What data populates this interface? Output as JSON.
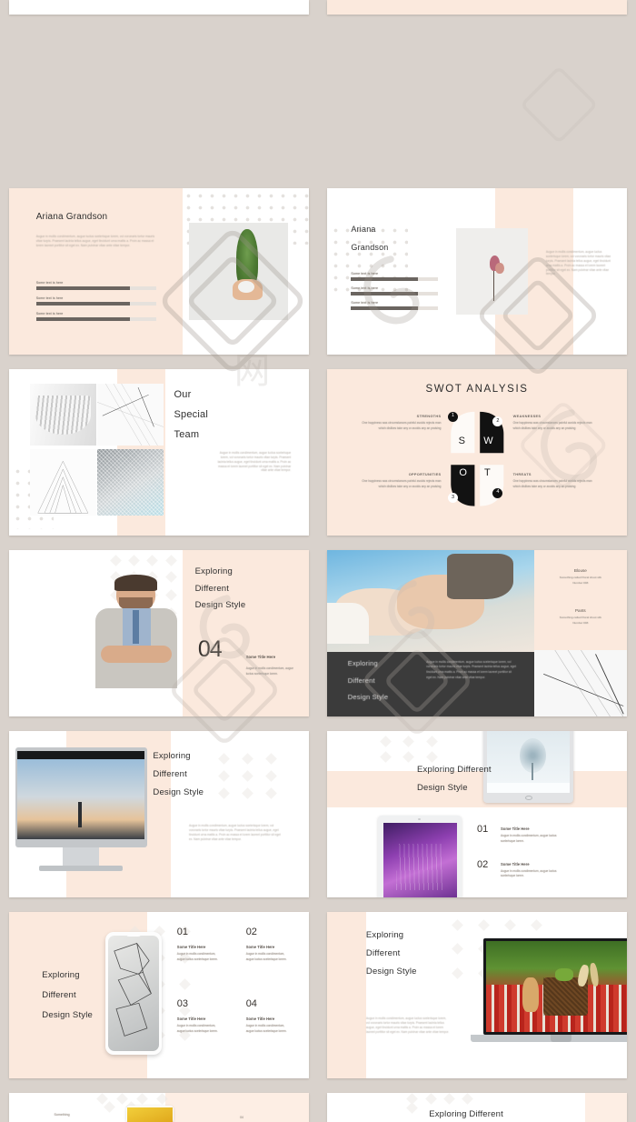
{
  "meta": {
    "kind": "presentation-template-preview-grid",
    "columns": 2,
    "background_color": "#d9d2cc",
    "accent_peach": "#fbe9dd",
    "accent_dark": "#3b3b3b",
    "text_dark": "#2f2f2f",
    "text_muted": "#9a9289"
  },
  "watermark": {
    "text": "包图网"
  },
  "lorem": {
    "long": "Augue in mollis condimentum, augue luctus scelerisque lorem, vol voronaris tortor mauris vitae turpis. Praesent lacinia tellus augue, eget tincidunt urna mattis a. Proin ac massa et lorem laoreet porttitor sit eget ex. Nam pulvinar vitae ante vitae tempor.",
    "medium": "Augue in mollis condimentum, augue luctus scelerisque lorem, vol voronaris tortor mauris vitae turpis. Praesent lacinia tellus augue, eget tincidunt urna mattis a. Proin ac massa et lorem laoreet porttitor sit eget ex.",
    "short": "Augue in mollis condimentum, augue luctus scelerisque lorem.",
    "tiny": "Augue in mollis condimentum, augue luctus scelerisque lorem.",
    "swot_body": "One happiness was circumstances painful avoids rejects man which dislikes take any or avoids any an praising"
  },
  "slides": [
    {
      "id": "slide-01-top-left",
      "name": "partial-top-white",
      "kind": "partial"
    },
    {
      "id": "slide-02-top-right",
      "name": "partial-top-peach",
      "kind": "partial"
    },
    {
      "id": "slide-ariana-1",
      "name": "profile-left-peach",
      "title": "Ariana Grandson",
      "bars": [
        {
          "label": "Some text is here",
          "percent": 78
        },
        {
          "label": "Some text is here",
          "percent": 78
        },
        {
          "label": "Some text is here",
          "percent": 78
        }
      ],
      "image_alt": "hand-holding-potted-cypress"
    },
    {
      "id": "slide-ariana-2",
      "name": "profile-center-image",
      "title_line1": "Ariana",
      "title_line2": "Grandson",
      "bars": [
        {
          "label": "Some text is here",
          "percent": 75
        },
        {
          "label": "Some text is here",
          "percent": 75
        },
        {
          "label": "Some text is here",
          "percent": 75
        }
      ],
      "image_alt": "dried-pink-flower-stem"
    },
    {
      "id": "slide-our-special-team",
      "name": "team-collage",
      "title_lines": [
        "Our",
        "Special",
        "Team"
      ],
      "image_alts": [
        "white-architecture-fins",
        "wire-line-art",
        "pyramid-structure",
        "mesh-facade"
      ]
    },
    {
      "id": "slide-swot",
      "name": "swot-analysis",
      "title": "SWOT ANALYSIS",
      "letters": [
        "S",
        "W",
        "O",
        "T"
      ],
      "quadrants": [
        {
          "number": "1",
          "heading": "STRENGTHS",
          "align": "right"
        },
        {
          "number": "2",
          "heading": "WEAKNESSES",
          "align": "left"
        },
        {
          "number": "3",
          "heading": "OPPORTUNITIES",
          "align": "right"
        },
        {
          "number": "4",
          "heading": "THREATS",
          "align": "left"
        }
      ]
    },
    {
      "id": "slide-portrait-04",
      "name": "portrait-number-04",
      "title_lines": [
        "Exploring",
        "Different",
        "Design Style"
      ],
      "number": "04",
      "sub_title": "Some Title Here",
      "sub_body": "Augue in mollis condimentum, augue luctus scelerisque lorem.",
      "image_alt": "businessman-arms-crossed"
    },
    {
      "id": "slide-handshake",
      "name": "handshake-dark-band",
      "title_lines": [
        "Exploring",
        "Different",
        "Design Style"
      ],
      "side_items": [
        {
          "name": "Blouse",
          "desc": "Something called Floral shoot silk",
          "number": "Number 008"
        },
        {
          "name": "Pants",
          "desc": "Something called Floral shoot silk",
          "number": "Number 008"
        }
      ],
      "image_alt": "business-handshake"
    },
    {
      "id": "slide-imac",
      "name": "desktop-monitor-mockup",
      "title_lines": [
        "Exploring",
        "Different",
        "Design Style"
      ],
      "image_alt": "imac-displaying-eiffel-tower-sunset"
    },
    {
      "id": "slide-tablets",
      "name": "tablet-mockups-list",
      "title_lines": [
        "Exploring Different",
        "Design Style"
      ],
      "items": [
        {
          "number": "01",
          "title": "Some Title Here",
          "body": "Augue in mollis condimentum, augue luctus scelerisque lorem."
        },
        {
          "number": "02",
          "title": "Some Title Here",
          "body": "Augue in mollis condimentum, augue luctus scelerisque lorem."
        }
      ],
      "image_alts": [
        "tablet-winter-tree",
        "tablet-purple-lavender"
      ]
    },
    {
      "id": "slide-phone-four",
      "name": "phone-mockup-four-items",
      "title_lines": [
        "Exploring",
        "Different",
        "Design Style"
      ],
      "items": [
        {
          "number": "01",
          "title": "Some Title Here",
          "body": "Augue in mollis condimentum, augue luctus scelerisque lorem."
        },
        {
          "number": "02",
          "title": "Some Title Here",
          "body": "Augue in mollis condimentum, augue luctus scelerisque lorem."
        },
        {
          "number": "03",
          "title": "Some Title Here",
          "body": "Augue in mollis condimentum, augue luctus scelerisque lorem."
        },
        {
          "number": "04",
          "title": "Some Title Here",
          "body": "Augue in mollis condimentum, augue luctus scelerisque lorem."
        }
      ],
      "image_alt": "smartphone-cracked-abstract"
    },
    {
      "id": "slide-laptop",
      "name": "laptop-mockup",
      "title_lines": [
        "Exploring",
        "Different",
        "Design Style"
      ],
      "body": "Augue in mollis condimentum, augue luctus scelerisque lorem, vol voronaris tortor mauris vitae turpis. Praesent lacinia tellus augue, eget tincidunt urna mattis a. Proin ac massa et lorem laoreet porttitor sit eget ex. Nam pulvinar vitae ante vitae tempor.",
      "image_alt": "laptop-cat-picnic-basket"
    },
    {
      "id": "slide-bottom-left",
      "name": "partial-bottom-something",
      "kind": "partial",
      "label": "Something",
      "number": "04"
    },
    {
      "id": "slide-bottom-right",
      "name": "partial-bottom-exploring",
      "kind": "partial",
      "title": "Exploring Different"
    }
  ]
}
